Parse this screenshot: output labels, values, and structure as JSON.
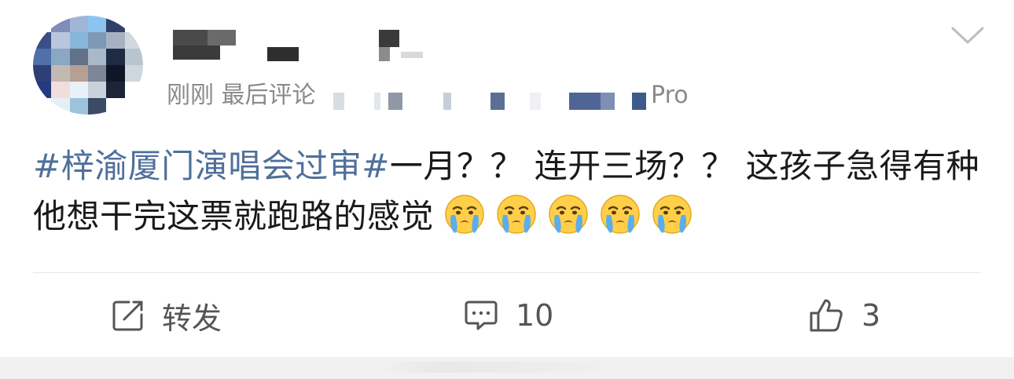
{
  "post": {
    "avatar": {
      "blurred": true
    },
    "username": {
      "blurred": true
    },
    "meta": {
      "time_source": "刚刚 最后评论",
      "device_suffix": "Pro"
    },
    "content": {
      "hashtag": "#梓渝厦门演唱会过审#",
      "text": "一月？？ 连开三场？？ 这孩子急得有种他想干完这票就跑路的感觉",
      "emoji_name": "crying-face",
      "emoji_count": 5
    }
  },
  "actions": {
    "repost_label": "转发",
    "comment_count": "10",
    "like_count": "3"
  },
  "icons": [
    "chevron-down-icon",
    "repost-icon",
    "comment-icon",
    "thumbs-up-icon",
    "crying-emoji-icon"
  ],
  "colors": {
    "hashtag": "#4f6f9b",
    "meta_text": "#8a8a8a",
    "action_text": "#555555",
    "divider": "#e6e6e6",
    "footer_bg": "#f1f1f1"
  }
}
